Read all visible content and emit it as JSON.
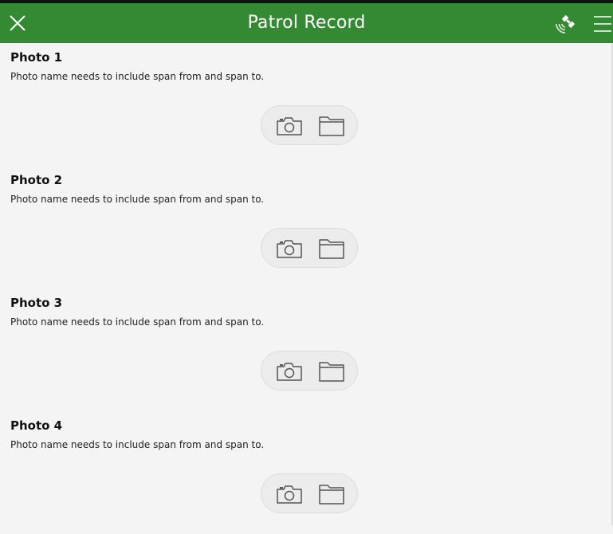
{
  "header": {
    "title": "Patrol Record",
    "background_color": "#338a33",
    "close_icon": "close-icon",
    "gps_icon": "satellite-icon",
    "menu_icon": "menu-icon"
  },
  "photos": [
    {
      "title": "Photo 1",
      "hint": "Photo name needs to include span from and span to.",
      "camera_icon": "camera-icon",
      "folder_icon": "folder-icon"
    },
    {
      "title": "Photo 2",
      "hint": "Photo name needs to include span from and span to.",
      "camera_icon": "camera-icon",
      "folder_icon": "folder-icon"
    },
    {
      "title": "Photo 3",
      "hint": "Photo name needs to include span from and span to.",
      "camera_icon": "camera-icon",
      "folder_icon": "folder-icon"
    },
    {
      "title": "Photo 4",
      "hint": "Photo name needs to include span from and span to.",
      "camera_icon": "camera-icon",
      "folder_icon": "folder-icon"
    }
  ]
}
